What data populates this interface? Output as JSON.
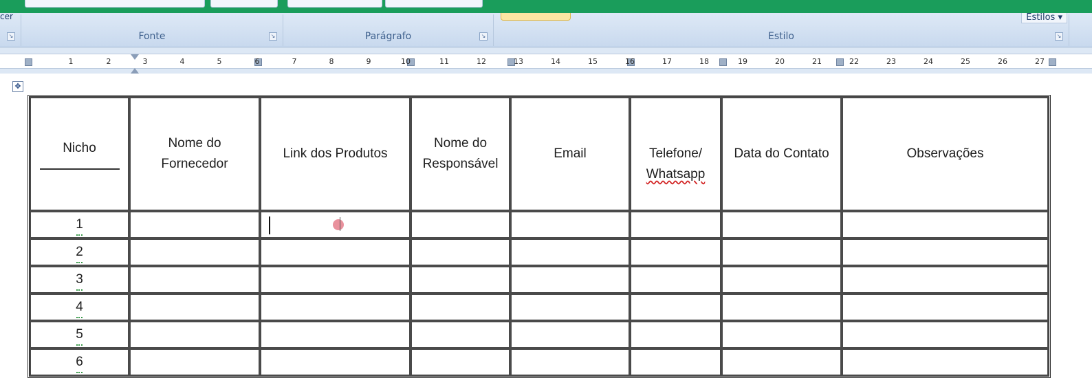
{
  "ribbon": {
    "cut_label": "cer",
    "styles_button": "Estilos ▾",
    "groups": [
      {
        "label": "Fonte"
      },
      {
        "label": "Parágrafo"
      },
      {
        "label": "Estilo"
      }
    ],
    "launcher_icon": "dialog-launcher-icon"
  },
  "ruler": {
    "numbers": [
      "1",
      "2",
      "3",
      "4",
      "5",
      "6",
      "7",
      "8",
      "9",
      "10",
      "11",
      "12",
      "13",
      "14",
      "15",
      "16",
      "17",
      "18",
      "19",
      "20",
      "21",
      "22",
      "23",
      "24",
      "25",
      "26",
      "27"
    ]
  },
  "table": {
    "headers": [
      "Nicho",
      "Nome do\nFornecedor",
      "Link dos Produtos",
      "Nome do\nResponsável",
      "Email",
      "Telefone/\nWhatsapp",
      "Data do Contato",
      "Observações"
    ],
    "rows": [
      "1",
      "2",
      "3",
      "4",
      "5",
      "6"
    ]
  },
  "colors": {
    "accent_green": "#1a9d5b",
    "ribbon_blue": "#d6e3f3",
    "cursor_highlight": "#e78592"
  }
}
